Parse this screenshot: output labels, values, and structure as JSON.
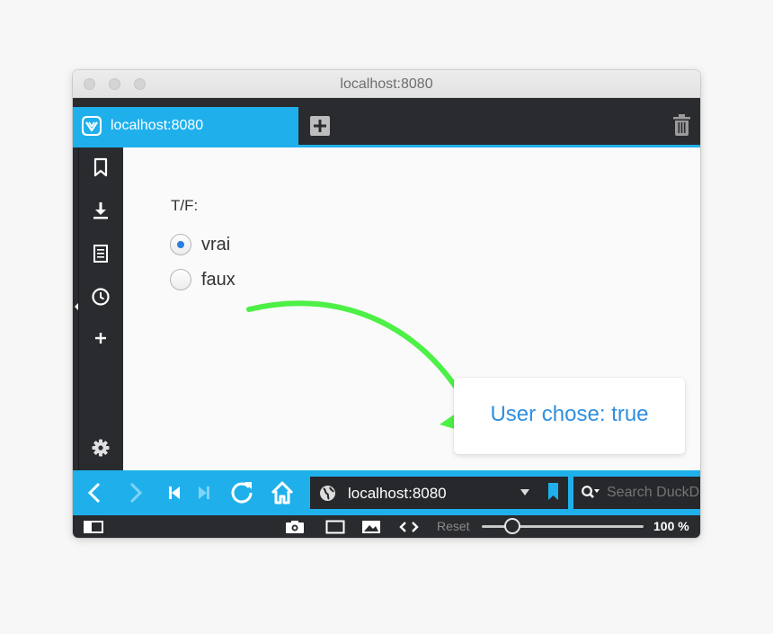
{
  "window": {
    "title": "localhost:8080"
  },
  "tab": {
    "title": "localhost:8080"
  },
  "form": {
    "legend": "T/F:",
    "options": [
      {
        "label": "vrai",
        "checked": true
      },
      {
        "label": "faux",
        "checked": false
      }
    ]
  },
  "annotation": {
    "arrow_color": "#4cf046"
  },
  "toast": {
    "text": "User chose: true"
  },
  "address_bar": {
    "url": "localhost:8080"
  },
  "search": {
    "placeholder": "Search DuckDuckGo"
  },
  "statusbar": {
    "reset_label": "Reset",
    "zoom": "100 %",
    "zoom_level": 0.18
  },
  "colors": {
    "accent": "#1fb0ec",
    "dark": "#2a2b2f",
    "toast_text": "#2f8fe0",
    "radio_dot": "#2b7fde"
  },
  "icons": {
    "sidebar": [
      "bookmark-icon",
      "download-icon",
      "notes-icon",
      "history-icon",
      "add-panel-icon",
      "settings-icon"
    ],
    "navbar": [
      "back-icon",
      "forward-icon",
      "rewind-icon",
      "fast-forward-icon",
      "reload-icon",
      "home-icon"
    ],
    "statusbar": [
      "panel-toggle-icon",
      "capture-icon",
      "tiling-icon",
      "image-icon",
      "page-actions-icon"
    ]
  }
}
